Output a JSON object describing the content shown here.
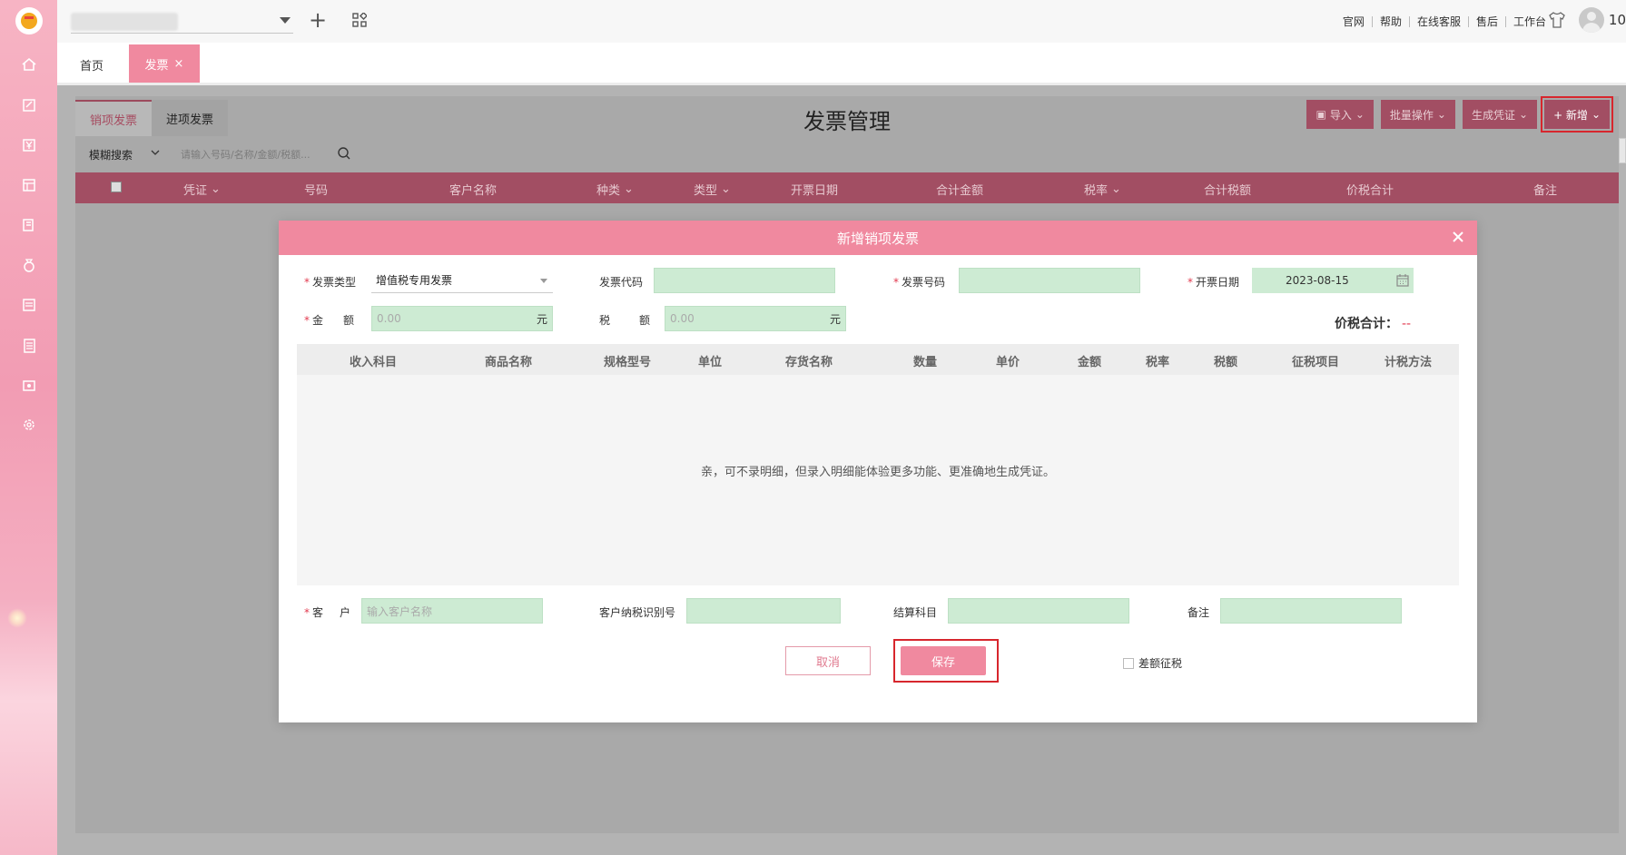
{
  "topbar": {
    "links": [
      "官网",
      "帮助",
      "在线客服",
      "售后",
      "工作台"
    ],
    "user_number": "10"
  },
  "tabs": {
    "home": "首页",
    "invoice": "发票",
    "close": "×"
  },
  "panel": {
    "inner_tabs": [
      "销项发票",
      "进项发票"
    ],
    "title": "发票管理",
    "actions": {
      "import": "导入",
      "batch": "批量操作",
      "voucher": "生成凭证",
      "new": "+ 新增"
    },
    "search": {
      "mode": "模糊搜索",
      "placeholder": "请输入号码/名称/金额/税额..."
    },
    "columns": [
      "凭证",
      "号码",
      "客户名称",
      "种类",
      "类型",
      "开票日期",
      "合计金额",
      "税率",
      "合计税额",
      "价税合计",
      "备注"
    ]
  },
  "modal": {
    "title": "新增销项发票",
    "fields": {
      "invoice_type_label": "发票类型",
      "invoice_type_value": "增值税专用发票",
      "invoice_code_label": "发票代码",
      "invoice_number_label": "发票号码",
      "issue_date_label": "开票日期",
      "issue_date_value": "2023-08-15",
      "amount_label_1": "金",
      "amount_label_2": "额",
      "amount_placeholder": "0.00",
      "amount_unit": "元",
      "tax_label_1": "税",
      "tax_label_2": "额",
      "tax_placeholder": "0.00",
      "tax_unit": "元",
      "total_label": "价税合计：",
      "total_value": "--"
    },
    "grid": {
      "columns": [
        "收入科目",
        "商品名称",
        "规格型号",
        "单位",
        "存货名称",
        "数量",
        "单价",
        "金额",
        "税率",
        "税额",
        "征税项目",
        "计税方法"
      ],
      "empty_text": "亲，可不录明细，但录入明细能体验更多功能、更准确地生成凭证。"
    },
    "bottom": {
      "customer_label_1": "客",
      "customer_label_2": "户",
      "customer_placeholder": "输入客户名称",
      "tax_id_label": "客户纳税识别号",
      "settlement_label": "结算科目",
      "remark_label": "备注"
    },
    "buttons": {
      "cancel": "取消",
      "save": "保存",
      "diff_tax": "差额征税"
    }
  },
  "colors": {
    "accent_pink": "#f0899f",
    "accent_dark": "#a24e63",
    "field_green": "#cdebd3",
    "required_red": "#e23a4f",
    "highlight_red": "#d7262d"
  }
}
